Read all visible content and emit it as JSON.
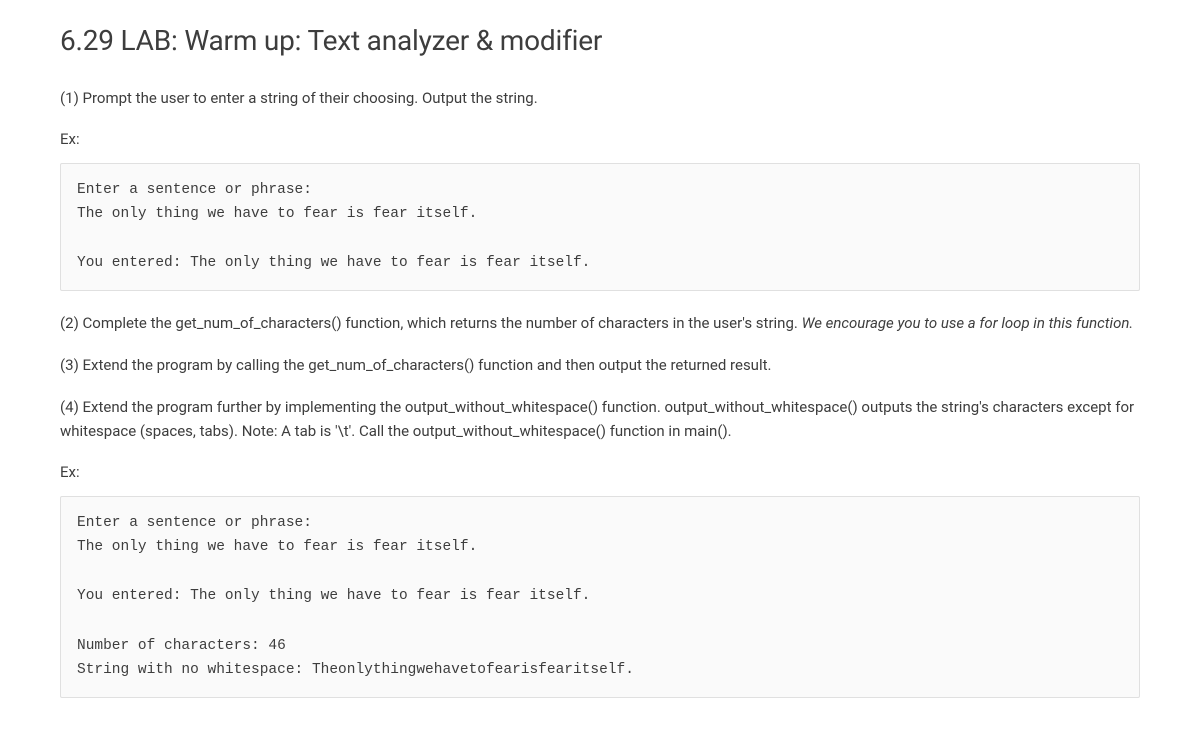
{
  "title": "6.29 LAB: Warm up: Text analyzer & modifier",
  "step1": "(1) Prompt the user to enter a string of their choosing. Output the string.",
  "ex1_label": "Ex:",
  "ex1_code": "Enter a sentence or phrase:\nThe only thing we have to fear is fear itself.\n\nYou entered: The only thing we have to fear is fear itself.",
  "step2_a": "(2) Complete the get_num_of_characters() function, which returns the number of characters in the user's string. ",
  "step2_b": "We encourage you to use a for loop in this function.",
  "step3": "(3) Extend the program by calling the get_num_of_characters() function and then output the returned result.",
  "step4": "(4) Extend the program further by implementing the output_without_whitespace() function. output_without_whitespace() outputs the string's characters except for whitespace (spaces, tabs). Note: A tab is '\\t'. Call the output_without_whitespace() function in main().",
  "ex2_label": "Ex:",
  "ex2_code": "Enter a sentence or phrase:\nThe only thing we have to fear is fear itself.\n\nYou entered: The only thing we have to fear is fear itself.\n\nNumber of characters: 46\nString with no whitespace: Theonlythingwehavetofearisfearitself."
}
